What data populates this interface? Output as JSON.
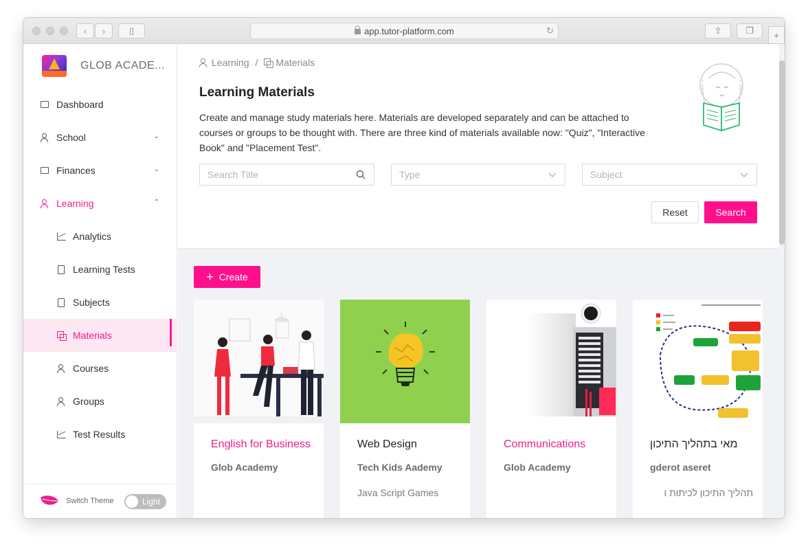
{
  "browser": {
    "url": "app.tutor-platform.com"
  },
  "brand": {
    "name": "GLOB ACADE..."
  },
  "sidebar": {
    "items": [
      {
        "label": "Dashboard"
      },
      {
        "label": "School"
      },
      {
        "label": "Finances"
      },
      {
        "label": "Learning"
      },
      {
        "label": "Analytics"
      },
      {
        "label": "Learning Tests"
      },
      {
        "label": "Subjects"
      },
      {
        "label": "Materials"
      },
      {
        "label": "Courses"
      },
      {
        "label": "Groups"
      },
      {
        "label": "Test Results"
      }
    ],
    "footer": {
      "switch_label": "Switch Theme",
      "toggle_value": "Light"
    }
  },
  "breadcrumb": {
    "level1": "Learning",
    "separator": "/",
    "level2": "Materials"
  },
  "page": {
    "title": "Learning Materials",
    "description": "Create and manage study materials here. Materials are developed separately and can be attached to courses or groups to be thought with. There are three kind of materials available now: \"Quiz\", \"Interactive Book\" and \"Placement Test\"."
  },
  "filters": {
    "title_placeholder": "Search Title",
    "type_placeholder": "Type",
    "subject_placeholder": "Subject",
    "reset_label": "Reset",
    "search_label": "Search"
  },
  "actions": {
    "create_label": "Create"
  },
  "cards": [
    {
      "title": "English for Business",
      "org": "Glob Academy",
      "subject": ""
    },
    {
      "title": "Web Design",
      "org": "Tech Kids Aademy",
      "subject": "Java Script Games"
    },
    {
      "title": "Communications",
      "org": "Glob Academy",
      "subject": ""
    },
    {
      "title": "מאי בתהליך התיכון",
      "org": "gderot aseret",
      "subject": "תהליך התיכון לכיתות ו"
    }
  ],
  "colors": {
    "accent": "#ff0f8c",
    "selected_bg": "#fde7f2",
    "card3_bg": "#8fd14f"
  }
}
